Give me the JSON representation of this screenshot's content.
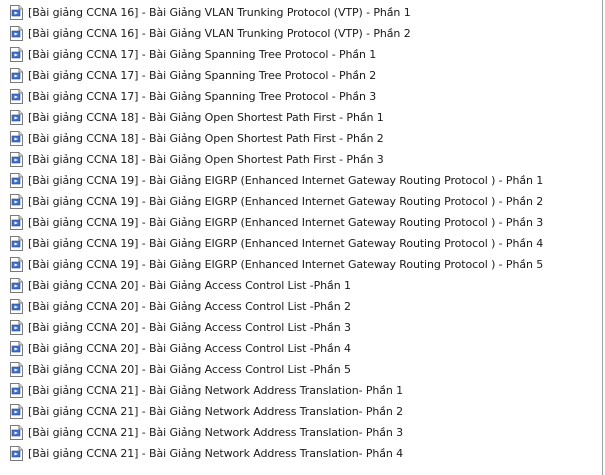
{
  "file_list": {
    "icon": "media-file-icon",
    "items": [
      "[Bài giảng CCNA 16] - Bài Giảng VLAN Trunking Protocol (VTP) - Phần 1",
      "[Bài giảng CCNA 16] - Bài Giảng VLAN Trunking Protocol (VTP) - Phần 2",
      "[Bài giảng CCNA 17] - Bài Giảng Spanning Tree Protocol - Phần 1",
      "[Bài giảng CCNA 17] - Bài Giảng Spanning Tree Protocol - Phần 2",
      "[Bài giảng CCNA 17] - Bài Giảng Spanning Tree Protocol - Phần 3",
      "[Bài giảng CCNA 18] - Bài Giảng Open Shortest Path First - Phần 1",
      "[Bài giảng CCNA 18] - Bài Giảng Open Shortest Path First - Phần 2",
      "[Bài giảng CCNA 18] - Bài Giảng Open Shortest Path First - Phần 3",
      "[Bài giảng CCNA 19] - Bài Giảng EIGRP (Enhanced Internet Gateway Routing Protocol ) - Phần 1",
      "[Bài giảng CCNA 19] - Bài Giảng EIGRP (Enhanced Internet Gateway Routing Protocol ) - Phần 2",
      "[Bài giảng CCNA 19] - Bài Giảng EIGRP (Enhanced Internet Gateway Routing Protocol ) - Phần 3",
      "[Bài giảng CCNA 19] - Bài Giảng EIGRP (Enhanced Internet Gateway Routing Protocol ) - Phần 4",
      "[Bài giảng CCNA 19] - Bài Giảng EIGRP (Enhanced Internet Gateway Routing Protocol ) - Phần 5",
      "[Bài giảng CCNA 20] - Bài Giảng Access Control List -Phần 1",
      "[Bài giảng CCNA 20] - Bài Giảng Access Control List -Phần 2",
      "[Bài giảng CCNA 20] - Bài Giảng Access Control List -Phần 3",
      "[Bài giảng CCNA 20] - Bài Giảng Access Control List -Phần 4",
      "[Bài giảng CCNA 20] - Bài Giảng Access Control List -Phần 5",
      "[Bài giảng CCNA 21] - Bài Giảng Network Address Translation- Phần 1",
      "[Bài giảng CCNA 21] - Bài Giảng Network Address Translation- Phần 2",
      "[Bài giảng CCNA 21] - Bài Giảng Network Address Translation- Phần 3",
      "[Bài giảng CCNA 21] - Bài Giảng Network Address Translation- Phần 4"
    ]
  }
}
